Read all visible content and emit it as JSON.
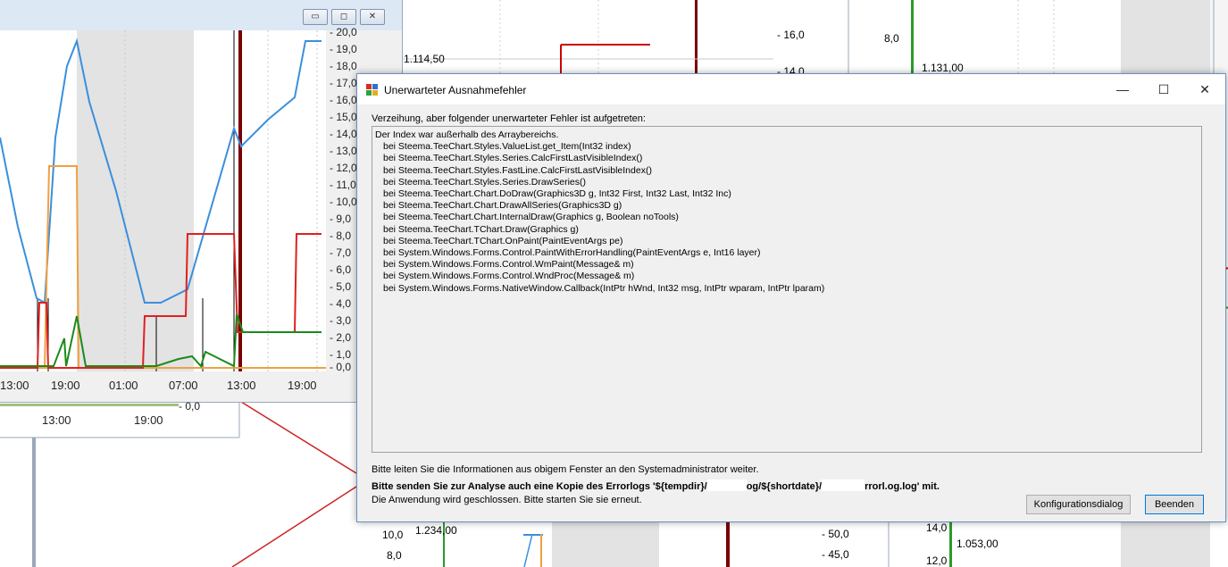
{
  "background": {
    "chart_window": {
      "minimize": "▭",
      "restore": "◻",
      "close": "✕",
      "right_axis_ticks": [
        "- 20,0",
        "- 19,0",
        "- 18,0",
        "- 17,0",
        "- 16,0",
        "- 15,0",
        "- 14,0",
        "- 13,0",
        "- 12,0",
        "- 11,0",
        "- 10,0",
        "- 9,0",
        "- 8,0",
        "- 7,0",
        "- 6,0",
        "- 5,0",
        "- 4,0",
        "- 3,0",
        "- 2,0",
        "- 1,0",
        "- 0,0"
      ],
      "time_labels": [
        "13:00",
        "19:00",
        "01:00",
        "07:00",
        "13:00",
        "19:00"
      ],
      "lower_time_labels": [
        "13:00",
        "19:00"
      ],
      "lower_tick": "- 0,0"
    },
    "chart_mid": {
      "left_value": "1.114,50",
      "right_ticks": [
        "- 16,0",
        "- 14,0"
      ]
    },
    "chart_right": {
      "left_tick": "8,0",
      "left_value": "1.131,00"
    },
    "bottom_left": {
      "ticks": [
        "10,0",
        "8,0"
      ],
      "value": "1.234,00",
      "right_ticks": [
        "- 50,0",
        "- 45,0"
      ]
    },
    "bottom_right": {
      "ticks": [
        "14,0",
        "12,0"
      ],
      "value": "1.053,00"
    }
  },
  "dialog": {
    "title": "Unerwarteter Ausnahmefehler",
    "minimize": "—",
    "maximize": "☐",
    "close": "✕",
    "intro": "Verzeihung, aber folgender unerwarteter Fehler  ist aufgetreten:",
    "trace_header": "Der Index war außerhalb des Arraybereichs.",
    "trace_lines": [
      "bei Steema.TeeChart.Styles.ValueList.get_Item(Int32 index)",
      "bei Steema.TeeChart.Styles.Series.CalcFirstLastVisibleIndex()",
      "bei Steema.TeeChart.Styles.FastLine.CalcFirstLastVisibleIndex()",
      "bei Steema.TeeChart.Styles.Series.DrawSeries()",
      "bei Steema.TeeChart.Chart.DoDraw(Graphics3D g, Int32 First, Int32 Last, Int32 Inc)",
      "bei Steema.TeeChart.Chart.DrawAllSeries(Graphics3D g)",
      "bei Steema.TeeChart.Chart.InternalDraw(Graphics g, Boolean noTools)",
      "bei Steema.TeeChart.TChart.Draw(Graphics g)",
      "bei Steema.TeeChart.TChart.OnPaint(PaintEventArgs pe)",
      "bei System.Windows.Forms.Control.PaintWithErrorHandling(PaintEventArgs e, Int16 layer)",
      "bei System.Windows.Forms.Control.WmPaint(Message& m)",
      "bei System.Windows.Forms.Control.WndProc(Message& m)",
      "bei System.Windows.Forms.NativeWindow.Callback(IntPtr hWnd, Int32 msg, IntPtr wparam, IntPtr lparam)"
    ],
    "info_line1": "Bitte leiten Sie die Informationen aus obigem Fenster an den Systemadministrator weiter.",
    "info_line2_a": "Bitte senden Sie zur Analyse auch eine Kopie des Errorlogs '${tempdir}/",
    "info_line2_b": "og/${shortdate}/",
    "info_line2_c": "rrorl.og.log' mit.",
    "info_line3": "Die Anwendung wird geschlossen. Bitte starten Sie sie erneut.",
    "config_button": "Konfigurationsdialog",
    "exit_button": "Beenden"
  }
}
